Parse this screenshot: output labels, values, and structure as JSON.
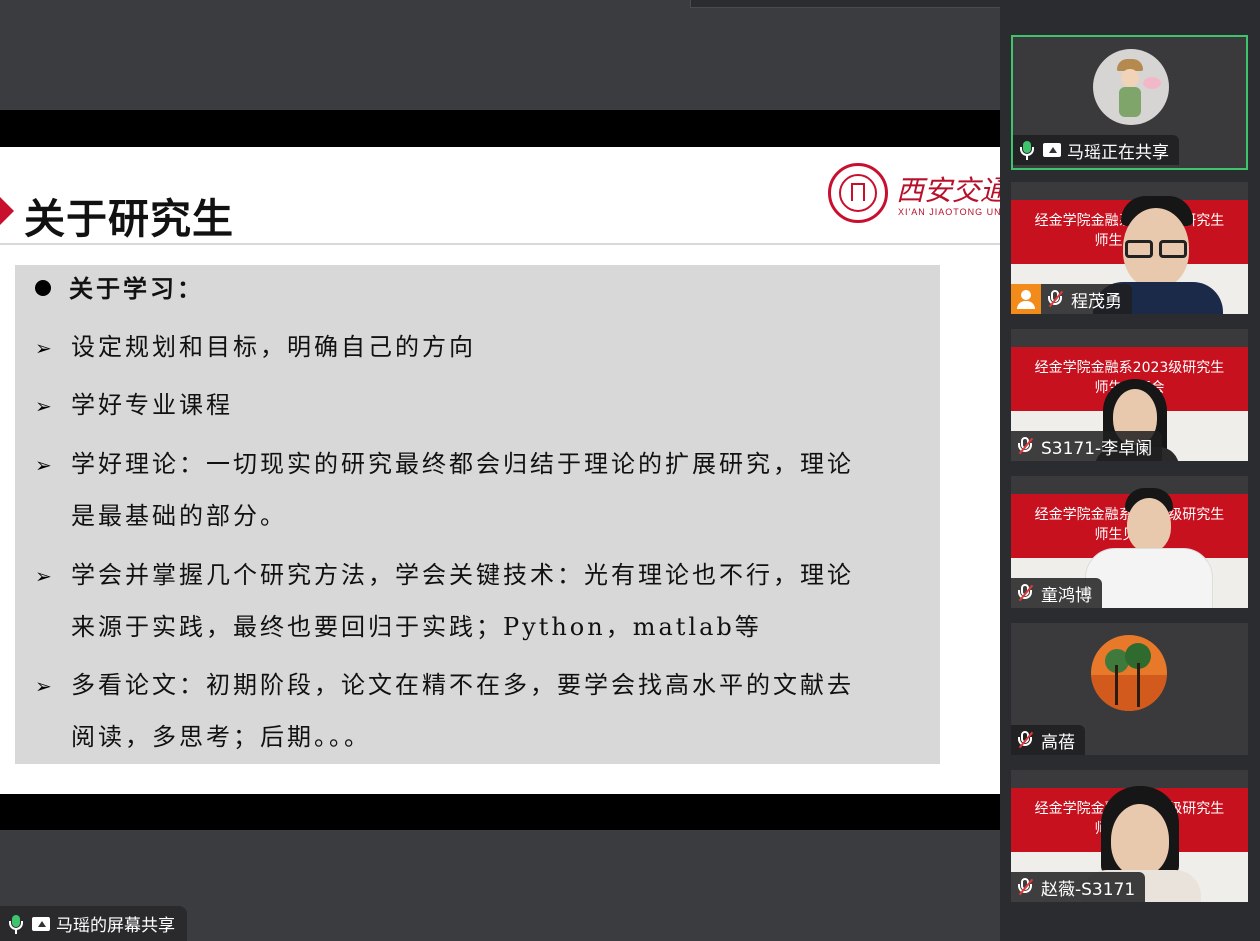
{
  "presenter_label": "马瑶的屏幕共享",
  "slide": {
    "title": "关于研究生",
    "logo_cn": "西安交通大",
    "logo_en": "XI'AN JIAOTONG UNI",
    "lines": [
      "关于学习：",
      "设定规划和目标，明确自己的方向",
      "学好专业课程",
      "学好理论：一切现实的研究最终都会归结于理论的扩展研究，理论",
      "是最基础的部分。",
      "学会并掌握几个研究方法，学会关键技术：光有理论也不行，理论",
      "来源于实践，最终也要回归于实践；Python，matlab等",
      "多看论文：初期阶段，论文在精不在多，要学会找高水平的文献去",
      "阅读，多思考；后期。。。"
    ]
  },
  "participants": [
    {
      "name": "马瑶正在共享",
      "mic": "on",
      "sharing": true,
      "active": true
    },
    {
      "name": "程茂勇",
      "mic": "off",
      "host": true,
      "banner": "经金学院金融系2023级研究生师生见面会"
    },
    {
      "name": "S3171-李卓阑",
      "mic": "off",
      "banner": "经金学院金融系2023级研究生师生见面会"
    },
    {
      "name": "童鸿博",
      "mic": "off",
      "banner": "经金学院金融系2023级研究生师生见面会"
    },
    {
      "name": "高蓓",
      "mic": "off"
    },
    {
      "name": "赵薇-S3171",
      "mic": "off",
      "banner": "经金学院金融系2023级研究生师生见面会"
    }
  ],
  "banner_lines": {
    "line1": "经金学院金融系2023级研究生",
    "line2": "师生见面会"
  },
  "colors": {
    "active_border": "#3ec46d",
    "mic_on": "#3ec46d",
    "mic_off_slash": "#e23a3a",
    "host_badge": "#f28b1a",
    "banner_red": "#c8111f",
    "brand_red": "#b8102a"
  }
}
